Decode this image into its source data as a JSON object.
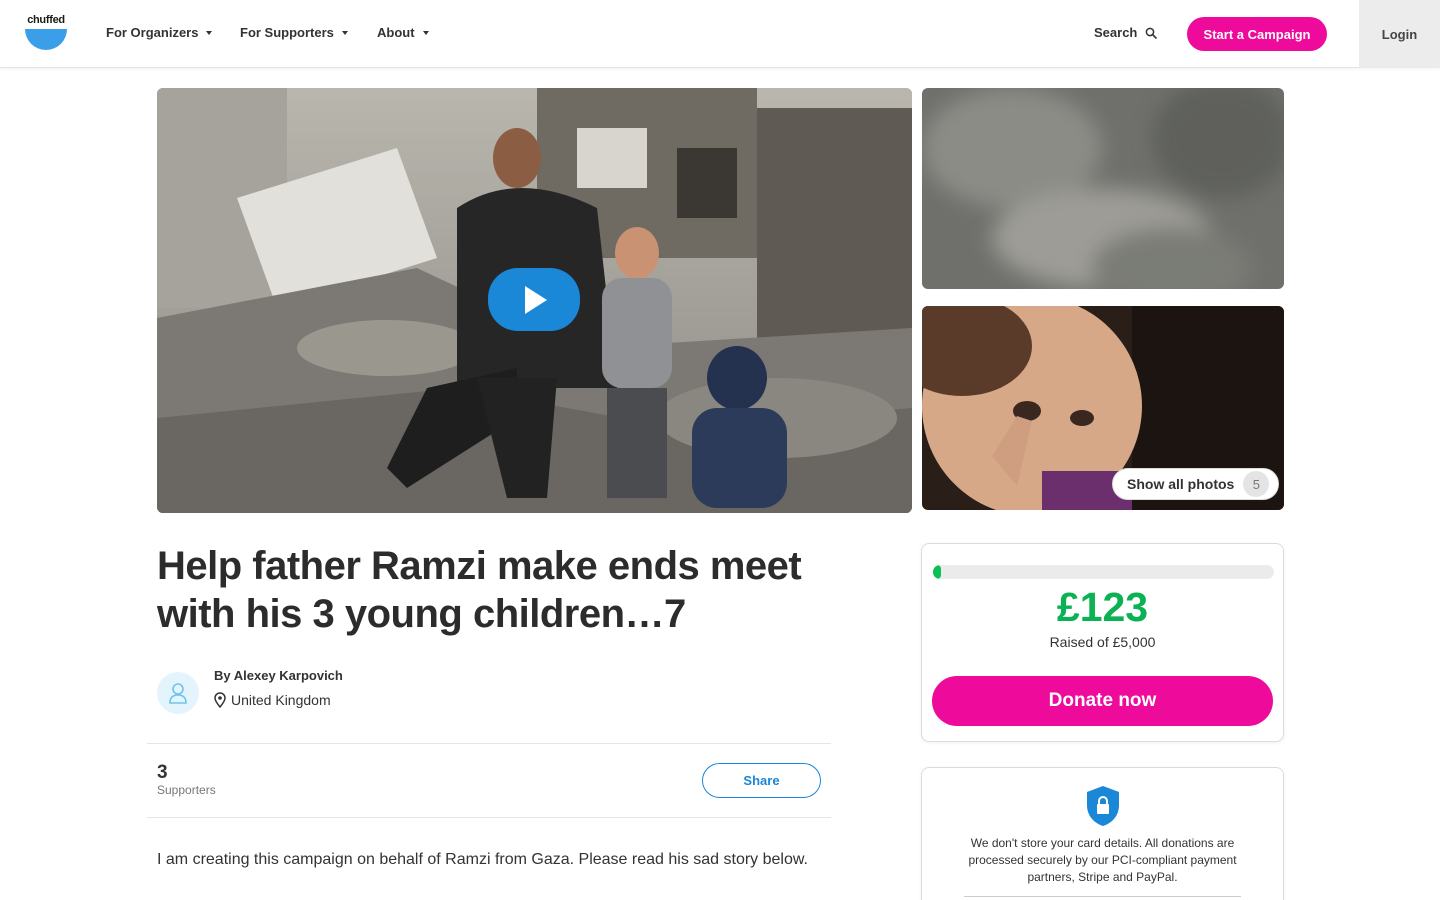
{
  "header": {
    "logo_text": "chuffed",
    "nav": [
      {
        "label": "For Organizers"
      },
      {
        "label": "For Supporters"
      },
      {
        "label": "About"
      }
    ],
    "search_label": "Search",
    "start_campaign_label": "Start a Campaign",
    "login_label": "Login"
  },
  "gallery": {
    "show_all_label": "Show all photos",
    "photo_count": "5"
  },
  "campaign": {
    "title": "Help father Ramzi make ends meet with his 3 young children…7",
    "organizer": "By Alexey Karpovich",
    "location": "United Kingdom",
    "supporters_count": "3",
    "supporters_label": "Supporters",
    "share_label": "Share",
    "story_intro": "I am creating this campaign on behalf of Ramzi from Gaza. Please read his sad story below."
  },
  "donation": {
    "raised_amount": "£123",
    "raised_of": "Raised of £5,000",
    "progress_fraction": 0.0246,
    "donate_label": "Donate now"
  },
  "security": {
    "text": "We don't store your card details. All donations are processed securely by our PCI-compliant payment partners, Stripe and PayPal."
  },
  "colors": {
    "brand_pink": "#ee0a9b",
    "brand_blue": "#1a87d7",
    "raised_green": "#0ab253"
  }
}
